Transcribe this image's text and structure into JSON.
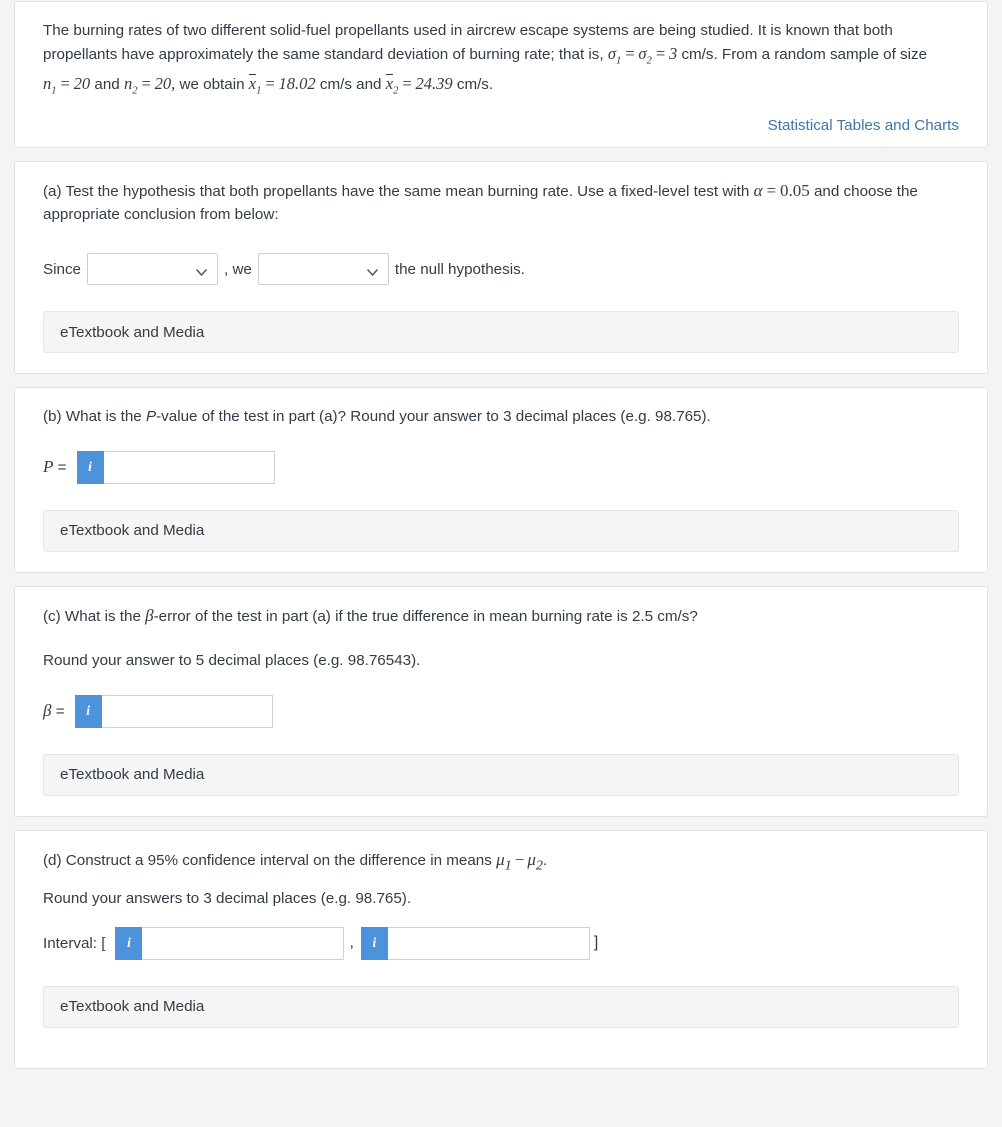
{
  "problem": {
    "text_part_1": "The burning rates of two different solid-fuel propellants used in aircrew escape systems are being studied. It is known that both propellants have approximately the same standard deviation of burning rate; that is,",
    "sigma1": "σ",
    "sigma1_sub": "1",
    "eq1": "=",
    "sigma2": "σ",
    "sigma2_sub": "2",
    "eq2": "=",
    "sigma_value": "3",
    "text_part_2": "cm/s. From a random sample of size",
    "n1": "n",
    "n1_sub": "1",
    "n1_eq": "=",
    "n1_value": "20",
    "and_1": "and",
    "n2": "n",
    "n2_sub": "2",
    "n2_eq": "=",
    "n2_value": "20,",
    "text_part_3": "we obtain",
    "xbar1": "x",
    "xbar1_sub": "1",
    "xbar1_eq": "=",
    "xbar1_value": "18.02",
    "units_1": "cm/s and",
    "xbar2": "x",
    "xbar2_sub": "2",
    "xbar2_eq": "=",
    "xbar2_value": "24.39",
    "units_2": "cm/s.",
    "tables_link": "Statistical Tables and Charts"
  },
  "part_a": {
    "question_pre": "(a) Test the hypothesis that both propellants have the same mean burning rate. Use a fixed-level test with",
    "alpha": "α",
    "alpha_eq": "=",
    "alpha_value": "0.05",
    "question_post": "and choose the appropriate conclusion from below:",
    "since_label": "Since",
    "select_1_value": "",
    "we_label": ", we",
    "select_2_value": "",
    "tail_label": "the null hypothesis.",
    "etextbook_label": "eTextbook and Media"
  },
  "part_b": {
    "question_pre": "(b) What is the",
    "question_italic": "P",
    "question_post": "-value of the test in part (a)? Round your answer to 3 decimal places (e.g. 98.765).",
    "answer_symbol": "P",
    "answer_equals": "=",
    "info_icon": "i",
    "input_value": "",
    "etextbook_label": "eTextbook and Media"
  },
  "part_c": {
    "question_pre": "(c) What is the",
    "question_symbol": "β",
    "question_post": "-error of the test in part (a) if the true difference in mean burning rate is 2.5 cm/s?",
    "round_note": "Round your answer to 5 decimal places (e.g. 98.76543).",
    "answer_symbol": "β",
    "answer_equals": "=",
    "info_icon": "i",
    "input_value": "",
    "etextbook_label": "eTextbook and Media"
  },
  "part_d": {
    "question_pre": "(d) Construct a 95% confidence interval on the difference in means",
    "mu1": "μ",
    "mu1_sub": "1",
    "minus": "−",
    "mu2": "μ",
    "mu2_sub": "2",
    "period": ".",
    "round_note": "Round your answers to 3 decimal places (e.g. 98.765).",
    "interval_label": "Interval: [",
    "info_icon_lower": "i",
    "lower_value": "",
    "separator": ",",
    "info_icon_upper": "i",
    "upper_value": "",
    "bracket_close": "]",
    "etextbook_label": "eTextbook and Media"
  },
  "colors": {
    "page_background": "#f4f4f4",
    "card_background": "#ffffff",
    "text": "#333b45",
    "link": "#3d77ab",
    "info_button": "#4d93db",
    "etextbook_background": "#f5f5f5"
  }
}
